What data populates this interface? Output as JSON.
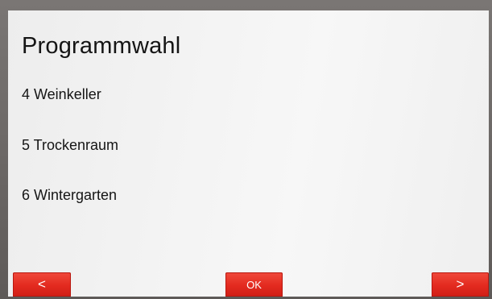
{
  "screen": {
    "title": "Programmwahl",
    "items": [
      {
        "label": "4 Weinkeller"
      },
      {
        "label": "5 Trockenraum"
      },
      {
        "label": "6 Wintergarten"
      }
    ]
  },
  "footer": {
    "prev_label": "<",
    "ok_label": "OK",
    "next_label": ">"
  },
  "colors": {
    "button_red": "#e32a1f",
    "screen_background": "#f3f3f3",
    "bezel": "#6f6b69"
  }
}
